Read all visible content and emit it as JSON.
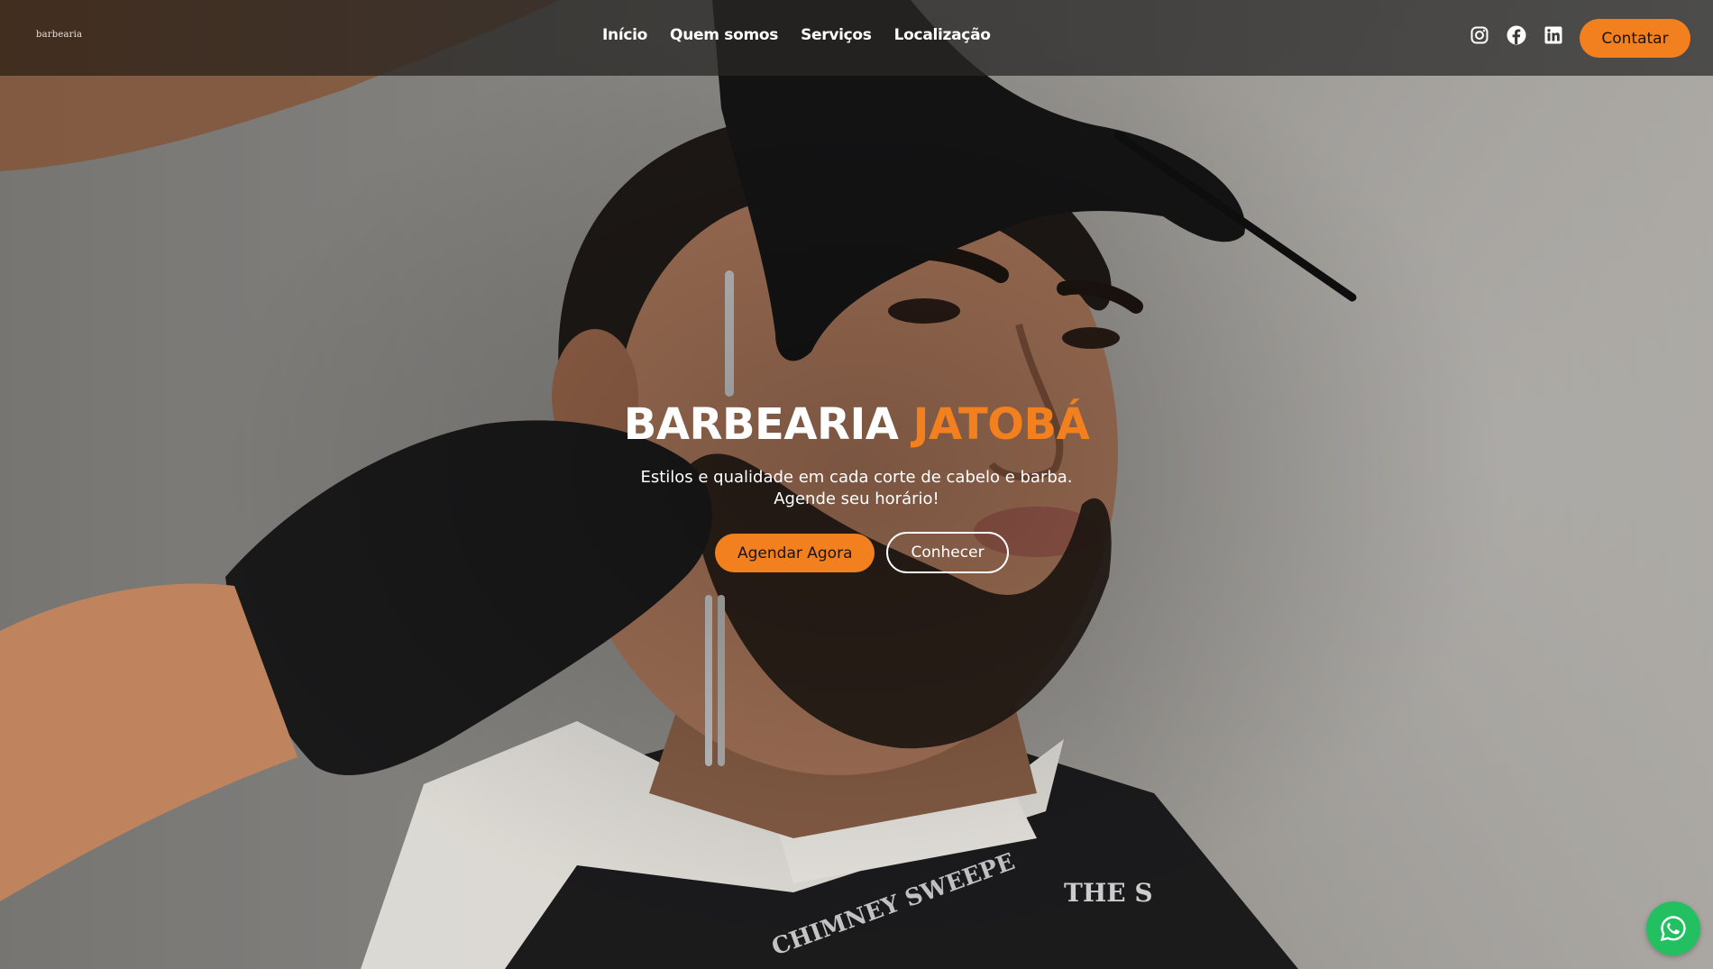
{
  "header": {
    "logo_text": "barbearia",
    "nav": [
      {
        "label": "Início"
      },
      {
        "label": "Quem somos"
      },
      {
        "label": "Serviços"
      },
      {
        "label": "Localização"
      }
    ],
    "socials": [
      {
        "icon": "instagram-icon"
      },
      {
        "icon": "facebook-icon"
      },
      {
        "icon": "linkedin-icon"
      }
    ],
    "contact_label": "Contatar"
  },
  "hero": {
    "title_main": "BARBEARIA",
    "title_accent": "JATOBÁ",
    "subtitle_line1": "Estilos e qualidade em cada corte de cabelo e barba.",
    "subtitle_line2": "Agende seu horário!",
    "primary_label": "Agendar Agora",
    "secondary_label": "Conhecer",
    "background_image": "barber-cutting-beard-photo"
  },
  "floating": {
    "whatsapp_icon": "whatsapp-icon"
  },
  "colors": {
    "accent": "#f2801f",
    "whatsapp": "#23c062",
    "text": "#ffffff"
  }
}
